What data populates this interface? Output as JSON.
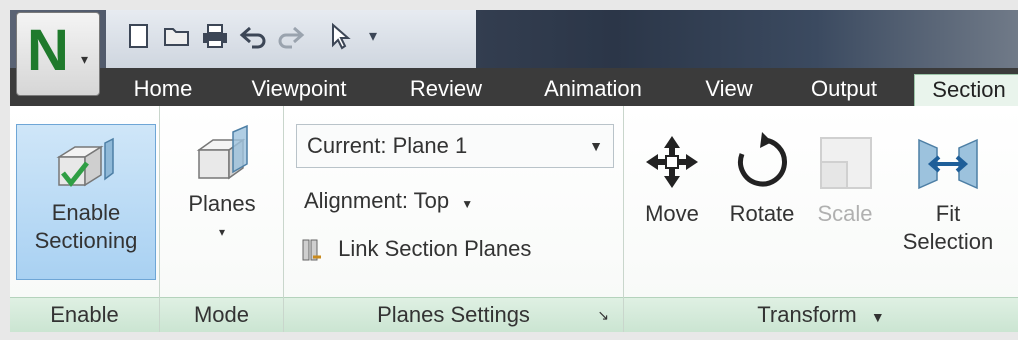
{
  "app": {
    "logo_letter": "N"
  },
  "tabs": [
    "Home",
    "Viewpoint",
    "Review",
    "Animation",
    "View",
    "Output",
    "Section"
  ],
  "groups": {
    "enable": {
      "label": "Enable",
      "button_line1": "Enable",
      "button_line2": "Sectioning"
    },
    "mode": {
      "label": "Mode",
      "button": "Planes"
    },
    "planes_settings": {
      "label": "Planes Settings",
      "current_plane": "Current: Plane 1",
      "alignment": "Alignment: Top",
      "link": "Link Section Planes"
    },
    "transform": {
      "label": "Transform",
      "move": "Move",
      "rotate": "Rotate",
      "scale": "Scale",
      "fit_line1": "Fit",
      "fit_line2": "Selection"
    }
  },
  "colors": {
    "accent": "#2f9e44",
    "active_tab": "#e9f4ec",
    "selected_button": "#a9d1f2"
  }
}
